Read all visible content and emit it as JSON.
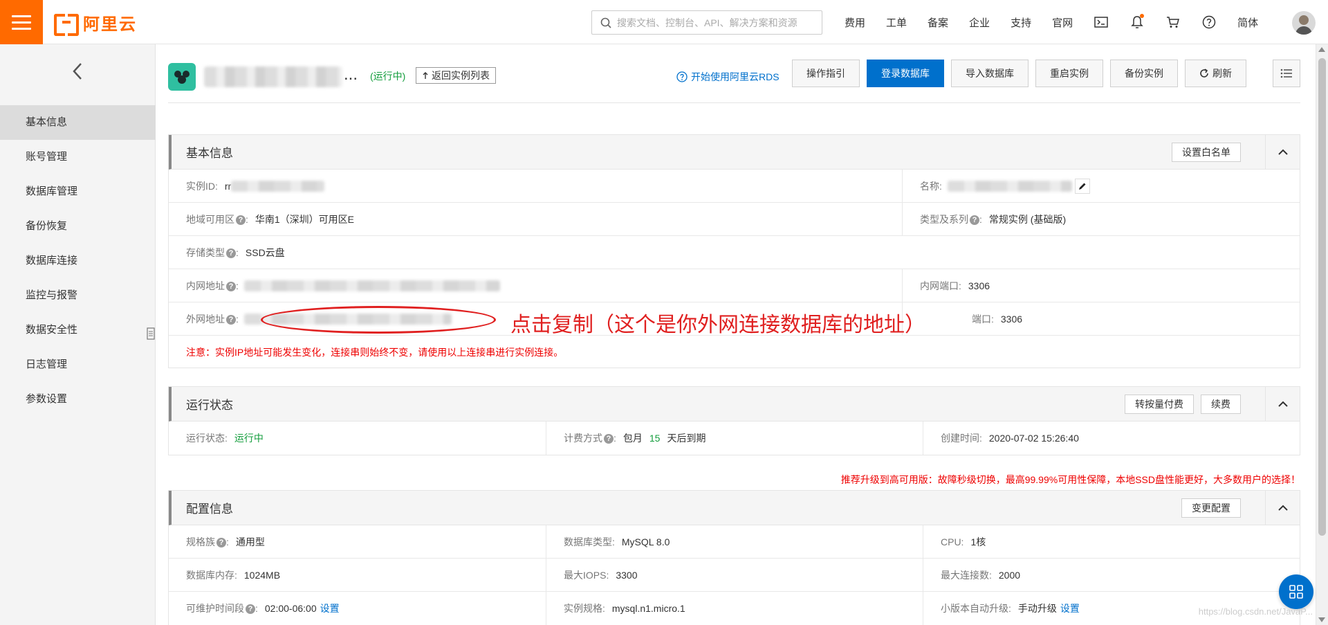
{
  "topbar": {
    "logo_text": "阿里云",
    "search_placeholder": "搜索文档、控制台、API、解决方案和资源",
    "nav": [
      "费用",
      "工单",
      "备案",
      "企业",
      "支持",
      "官网"
    ],
    "lang": "简体",
    "icons": [
      "terminal-icon",
      "bell-icon",
      "cart-icon",
      "help-icon"
    ]
  },
  "sidebar": {
    "items": [
      "基本信息",
      "账号管理",
      "数据库管理",
      "备份恢复",
      "数据库连接",
      "监控与报警",
      "数据安全性",
      "日志管理",
      "参数设置"
    ],
    "active_index": 0
  },
  "header": {
    "status": "(运行中)",
    "back_to_list": "返回实例列表",
    "help_link": "开始使用阿里云RDS",
    "actions": [
      "操作指引",
      "登录数据库",
      "导入数据库",
      "重启实例",
      "备份实例",
      "刷新"
    ]
  },
  "basic": {
    "title": "基本信息",
    "whitelist_btn": "设置白名单",
    "instance_id_label": "实例ID:",
    "instance_id_prefix": "rr",
    "name_label": "名称:",
    "region_label": "地域可用区",
    "region_value": "华南1（深圳）可用区E",
    "type_label": "类型及系列",
    "type_value": "常规实例 (基础版)",
    "storage_label": "存储类型",
    "storage_value": "SSD云盘",
    "intranet_label": "内网地址",
    "intranet_port_label": "内网端口:",
    "intranet_port": "3306",
    "internet_label": "外网地址",
    "internet_port_label": "端口:",
    "internet_port": "3306",
    "notice": "注意：实例IP地址可能发生变化，连接串则始终不变，请使用以上连接串进行实例连接。"
  },
  "annotation": "点击复制（这个是你外网连接数据库的地址）",
  "status": {
    "title": "运行状态",
    "btn_pay": "转按量付费",
    "btn_renew": "续费",
    "run_label": "运行状态:",
    "run_value": "运行中",
    "billing_label": "计费方式",
    "billing_value_pre": "包月",
    "billing_days": "15",
    "billing_value_post": "天后到期",
    "created_label": "创建时间:",
    "created_value": "2020-07-02 15:26:40"
  },
  "promo": "推荐升级到高可用版：故障秒级切换，最高99.99%可用性保障，本地SSD盘性能更好，大多数用户的选择！",
  "config": {
    "title": "配置信息",
    "change_btn": "变更配置",
    "family_label": "规格族",
    "family_value": "通用型",
    "dbtype_label": "数据库类型:",
    "dbtype_value": "MySQL 8.0",
    "cpu_label": "CPU:",
    "cpu_value": "1核",
    "memory_label": "数据库内存:",
    "memory_value": "1024MB",
    "iops_label": "最大IOPS:",
    "iops_value": "3300",
    "conn_label": "最大连接数:",
    "conn_value": "2000",
    "maint_label": "可维护时间段",
    "maint_value": "02:00-06:00",
    "maint_link": "设置",
    "spec_label": "实例规格:",
    "spec_value": "mysql.n1.micro.1",
    "upgrade_label": "小版本自动升级:",
    "upgrade_value": "手动升级",
    "upgrade_link": "设置"
  },
  "watermark": "https://blog.csdn.net/JavaP...",
  "colors": {
    "brand": "#ff6a00",
    "primary": "#0070cc",
    "running": "#139d3c",
    "warning": "#e00000"
  }
}
